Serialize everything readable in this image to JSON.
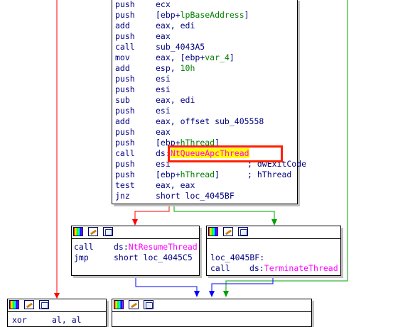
{
  "main_block": {
    "lines": [
      {
        "mn": "push",
        "op": "ecx"
      },
      {
        "mn": "push",
        "op_pre": "[ebp+",
        "op_var": "lpBaseAddress",
        "op_post": "]"
      },
      {
        "mn": "add",
        "op": "eax, edi"
      },
      {
        "mn": "push",
        "op": "eax"
      },
      {
        "mn": "call",
        "op": "sub_4043A5"
      },
      {
        "mn": "mov",
        "op_pre": "eax, [ebp+",
        "op_var": "var_4",
        "op_post": "]"
      },
      {
        "mn": "add",
        "op_pre": "esp, ",
        "op_num": "10h"
      },
      {
        "mn": "push",
        "op": "esi"
      },
      {
        "mn": "push",
        "op": "esi"
      },
      {
        "mn": "sub",
        "op": "eax, edi"
      },
      {
        "mn": "push",
        "op": "esi"
      },
      {
        "mn": "add",
        "op": "eax, offset sub_405558"
      },
      {
        "mn": "push",
        "op": "eax"
      },
      {
        "mn": "push",
        "op_pre": "[ebp+",
        "op_var": "hThread",
        "op_post": "]"
      },
      {
        "mn": "call",
        "op_pre": "ds:",
        "op_imp": "NtQueueApcThread"
      },
      {
        "mn": "push",
        "op": "esi",
        "cmt": "; dwExitCode"
      },
      {
        "mn": "push",
        "op_pre": "[ebp+",
        "op_var": "hThread",
        "op_post": "]",
        "cmt": "; hThread"
      },
      {
        "mn": "test",
        "op": "eax, eax"
      },
      {
        "mn": "jnz",
        "op": "short loc_4045BF"
      }
    ]
  },
  "left_block": {
    "lines": [
      {
        "mn": "call",
        "op_pre": "ds:",
        "op_imp": "NtResumeThread"
      },
      {
        "mn": "jmp",
        "op": "short loc_4045C5"
      }
    ]
  },
  "right_block": {
    "label": "loc_4045BF:",
    "lines": [
      {
        "mn": "call",
        "op_pre": "ds:",
        "op_imp": "TerminateThread"
      }
    ]
  },
  "bottom_left_block": {
    "lines": [
      {
        "mn": "xor",
        "op": "al, al"
      }
    ]
  },
  "colors": {
    "true_edge": "#00a000",
    "false_edge": "#ff0000",
    "uncond_edge": "#0000ff",
    "highlight_box": "#ff2000",
    "import_name": "#ff00ff",
    "variable": "#008000"
  }
}
